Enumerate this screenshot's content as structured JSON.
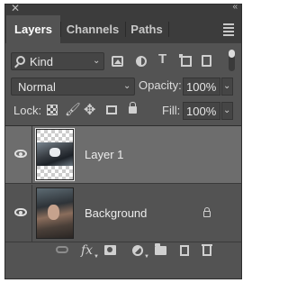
{
  "panel": {
    "close_glyph": "✕",
    "collapse_glyph": "«",
    "tabs": [
      {
        "label": "Layers",
        "active": true
      },
      {
        "label": "Channels",
        "active": false
      },
      {
        "label": "Paths",
        "active": false
      }
    ],
    "menu_icon": "hamburger-icon"
  },
  "filter": {
    "kind_label": "Kind",
    "icons": [
      "image-filter-icon",
      "adjustment-filter-icon",
      "type-filter-icon",
      "shape-filter-icon",
      "smart-object-filter-icon"
    ]
  },
  "blend": {
    "mode": "Normal",
    "opacity_label": "Opacity:",
    "opacity_value": "100%"
  },
  "lock": {
    "label": "Lock:",
    "fill_label": "Fill:",
    "fill_value": "100%"
  },
  "layers": [
    {
      "name": "Layer 1",
      "visible": true,
      "selected": true,
      "locked": false
    },
    {
      "name": "Background",
      "visible": true,
      "selected": false,
      "locked": true
    }
  ],
  "footer_icons": [
    "link-layers-icon",
    "fx-icon",
    "add-mask-icon",
    "adjustment-layer-icon",
    "new-group-icon",
    "new-layer-icon",
    "delete-icon"
  ],
  "footer_fx": "fx",
  "colors": {
    "panel_bg": "#535353",
    "tab_bar_bg": "#3c3c3c",
    "selected_layer_bg": "#6d6d6d"
  }
}
